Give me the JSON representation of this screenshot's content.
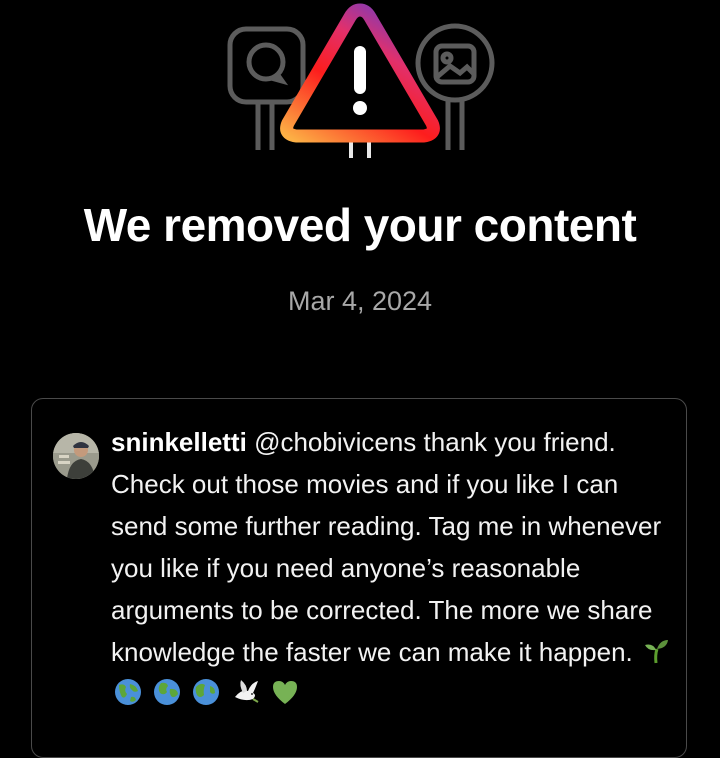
{
  "header": {
    "title": "We removed your content",
    "date": "Mar 4, 2024"
  },
  "icons": {
    "left": "speech-bubble-sign-icon",
    "center": "warning-triangle-icon",
    "right": "image-sign-icon"
  },
  "comment": {
    "username": "sninkelletti",
    "mention": "@chobivicens",
    "text": "thank you friend. Check out those movies and if you like I can send some further reading. Tag me in whenever you like if you need anyone’s reasonable arguments to be corrected. The more we share knowledge the faster we can make it happen.",
    "emojis": [
      "seedling-emoji",
      "globe-emoji",
      "globe-emoji",
      "globe-emoji",
      "dove-emoji",
      "green-heart-emoji"
    ]
  },
  "colors": {
    "background": "#000000",
    "date_text": "#a8a8a8",
    "card_border": "#4a4a4a",
    "gradient": [
      "#fcb045",
      "#fd1d1d",
      "#c13584",
      "#833ab4"
    ]
  }
}
